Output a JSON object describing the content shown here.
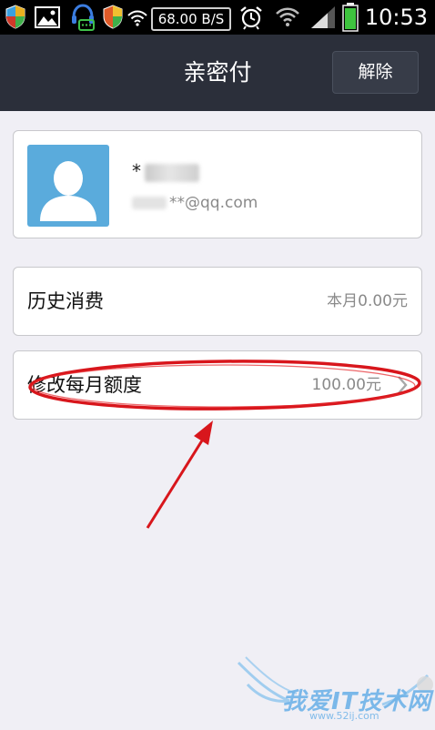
{
  "status_bar": {
    "net_speed": "68.00 B/S",
    "time": "10:53",
    "icons": [
      "shield-icon",
      "gallery-icon",
      "headset-chat-icon",
      "security-shield-icon",
      "wifi-icon",
      "alarm-icon",
      "wifi-signal-icon",
      "cell-signal-icon",
      "battery-icon"
    ]
  },
  "header": {
    "title": "亲密付",
    "unbind_label": "解除"
  },
  "profile": {
    "name_visible": "*",
    "email_suffix": "**@qq.com"
  },
  "rows": {
    "history": {
      "label": "历史消费",
      "value": "本月0.00元"
    },
    "limit": {
      "label": "修改每月额度",
      "value": "100.00元"
    }
  },
  "watermark": {
    "text": "我爱IT技术网",
    "url": "www.52ij.com"
  },
  "colors": {
    "status_bar": "#000000",
    "title_bar": "#2b2f3a",
    "background": "#f0eff5",
    "avatar": "#5aabdc",
    "annotation_red": "#d8161c",
    "battery": "#3ec43e"
  }
}
